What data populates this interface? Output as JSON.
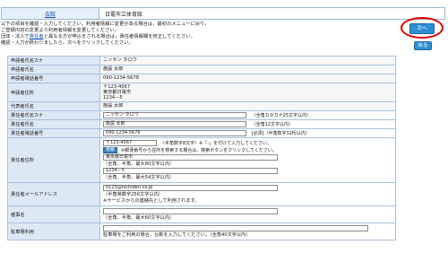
{
  "header": {
    "link": "会館",
    "facility": "日電市立体育館"
  },
  "intro": {
    "line1": "以下の項目を確認・入力してください。利用者情報に変更がある場合は，最初のメニューに戻り，",
    "line2": "ご登録内容の変更より利用者情報を変更してください。",
    "line3_pre": "団体・法人で",
    "line3_link": "責任者",
    "line3_post": "と異なる方が申込をされる場合は，責任者情報欄を修正してください。",
    "line4": "確認・入力が終わりましたら，次へをクリックしてください。"
  },
  "buttons": {
    "next": "次へ",
    "back": "戻る"
  },
  "applicant": {
    "kana_label": "申請者氏名カナ",
    "kana": "ニッセン タロウ",
    "name_label": "申請者氏名",
    "name": "施設 太郎",
    "tel_label": "申請者電話番号",
    "tel": "090-1234-5678",
    "addr_label": "申請者住所",
    "zip": "〒123-4567",
    "addr1": "東京都日電市",
    "addr2": "1234－5",
    "rep_label": "代表者氏名",
    "rep": "施設 太郎"
  },
  "responsible": {
    "kana_label": "責任者氏名カナ",
    "kana": "ニッセン タロウ",
    "kana_note": "（全角カタカナ25文字以内）",
    "name_label": "責任者氏名",
    "name": "施設 太郎",
    "name_note": "（全角12文字以内）",
    "tel_label": "責任者電話番号",
    "tel": "090-1234-5678",
    "tel_note": "[必須]（半角数字32桁以内）",
    "addr_label": "責任者住所",
    "zip": "〒123-4567",
    "zip_note": "（半角数字8文字）※「-」を付けて入力してください。",
    "search_btn": "検索",
    "search_note": "※郵便番号から住所を検索する場合は、検索ボタンをクリックしてください。",
    "addr1": "東京都日電市",
    "addr1_note": "（全角、半角、最大80文字以内）",
    "addr2": "1234－5",
    "addr2_note": "（全角、半角、最大54文字以内）",
    "mail_label": "責任者メールアドレス",
    "mail": "0123@nichiden.co.jp",
    "mail_note1": "（半角英数字256文字以内）",
    "mail_note2": "※サービスからの連絡先として利用されます。",
    "job_label": "催事名",
    "job_note": "（全角、半角、最大60文字以内）",
    "parking_label": "駐車場利用",
    "parking_note": "駐車場をご利用の場合，台数を入力してください。（全角40文字以内）"
  }
}
